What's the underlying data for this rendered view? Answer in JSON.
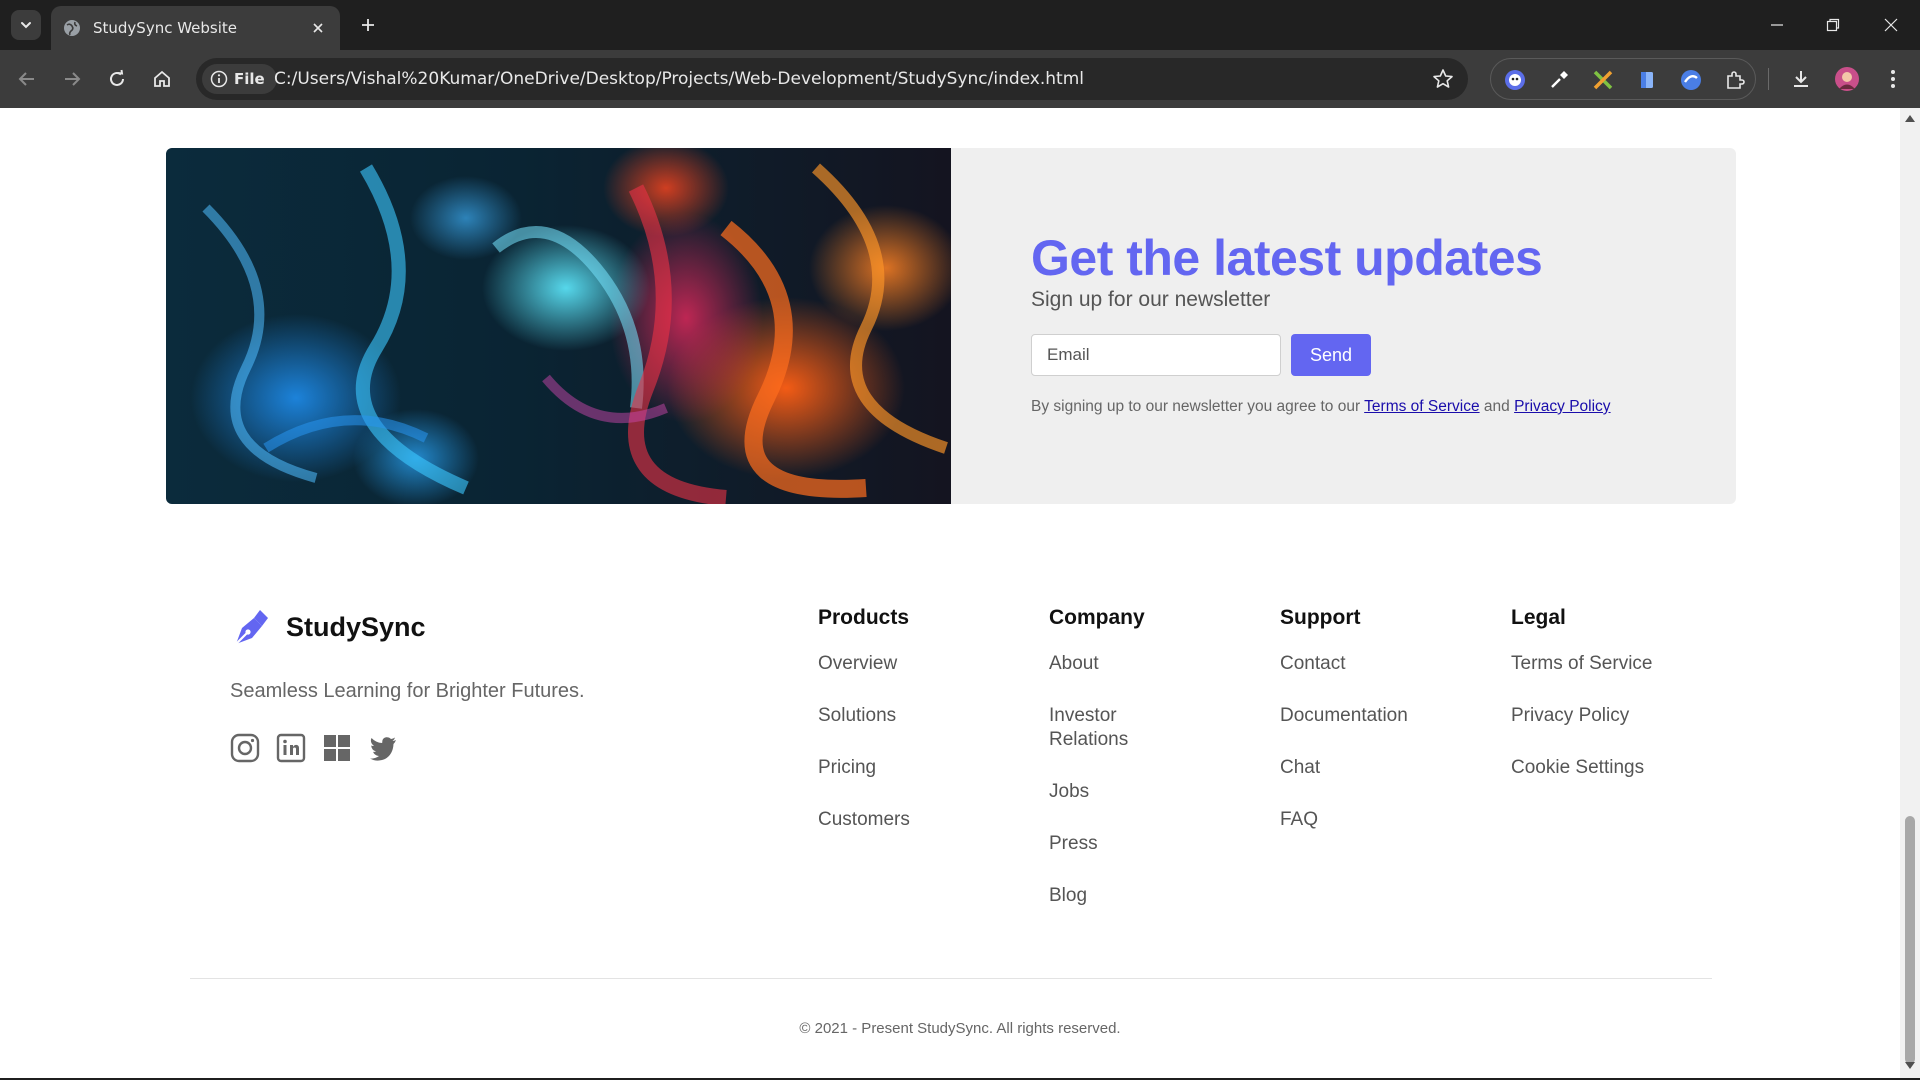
{
  "browser": {
    "tab_title": "StudySync Website",
    "site_chip": "File",
    "url": "C:/Users/Vishal%20Kumar/OneDrive/Desktop/Projects/Web-Development/StudySync/index.html",
    "icons": [
      "tab-list-icon",
      "globe-icon",
      "close-icon",
      "plus-icon",
      "minimize-icon",
      "restore-icon",
      "close-window-icon",
      "back-icon",
      "forward-icon",
      "reload-icon",
      "home-icon",
      "info-icon",
      "star-icon",
      "extension-icons",
      "download-icon",
      "profile-avatar",
      "more-icon"
    ]
  },
  "newsletter": {
    "title": "Get the latest updates",
    "subtitle": "Sign up for our newsletter",
    "email_placeholder": "Email",
    "send_label": "Send",
    "note_prefix": "By signing up to our newsletter you agree to our",
    "terms_link": "Terms of Service",
    "note_and": "and",
    "privacy_link": "Privacy Policy",
    "accent_color": "#6366f1"
  },
  "footer": {
    "brand_name": "StudySync",
    "tagline": "Seamless Learning for Brighter Futures.",
    "socials": [
      "instagram-icon",
      "linkedin-icon",
      "windows-icon",
      "twitter-icon"
    ],
    "columns": [
      {
        "heading": "Products",
        "links": [
          "Overview",
          "Solutions",
          "Pricing",
          "Customers"
        ]
      },
      {
        "heading": "Company",
        "links": [
          "About",
          "Investor Relations",
          "Jobs",
          "Press",
          "Blog"
        ]
      },
      {
        "heading": "Support",
        "links": [
          "Contact",
          "Documentation",
          "Chat",
          "FAQ"
        ]
      },
      {
        "heading": "Legal",
        "links": [
          "Terms of Service",
          "Privacy Policy",
          "Cookie Settings"
        ]
      }
    ],
    "copyright": "© 2021 - Present StudySync. All rights reserved."
  }
}
